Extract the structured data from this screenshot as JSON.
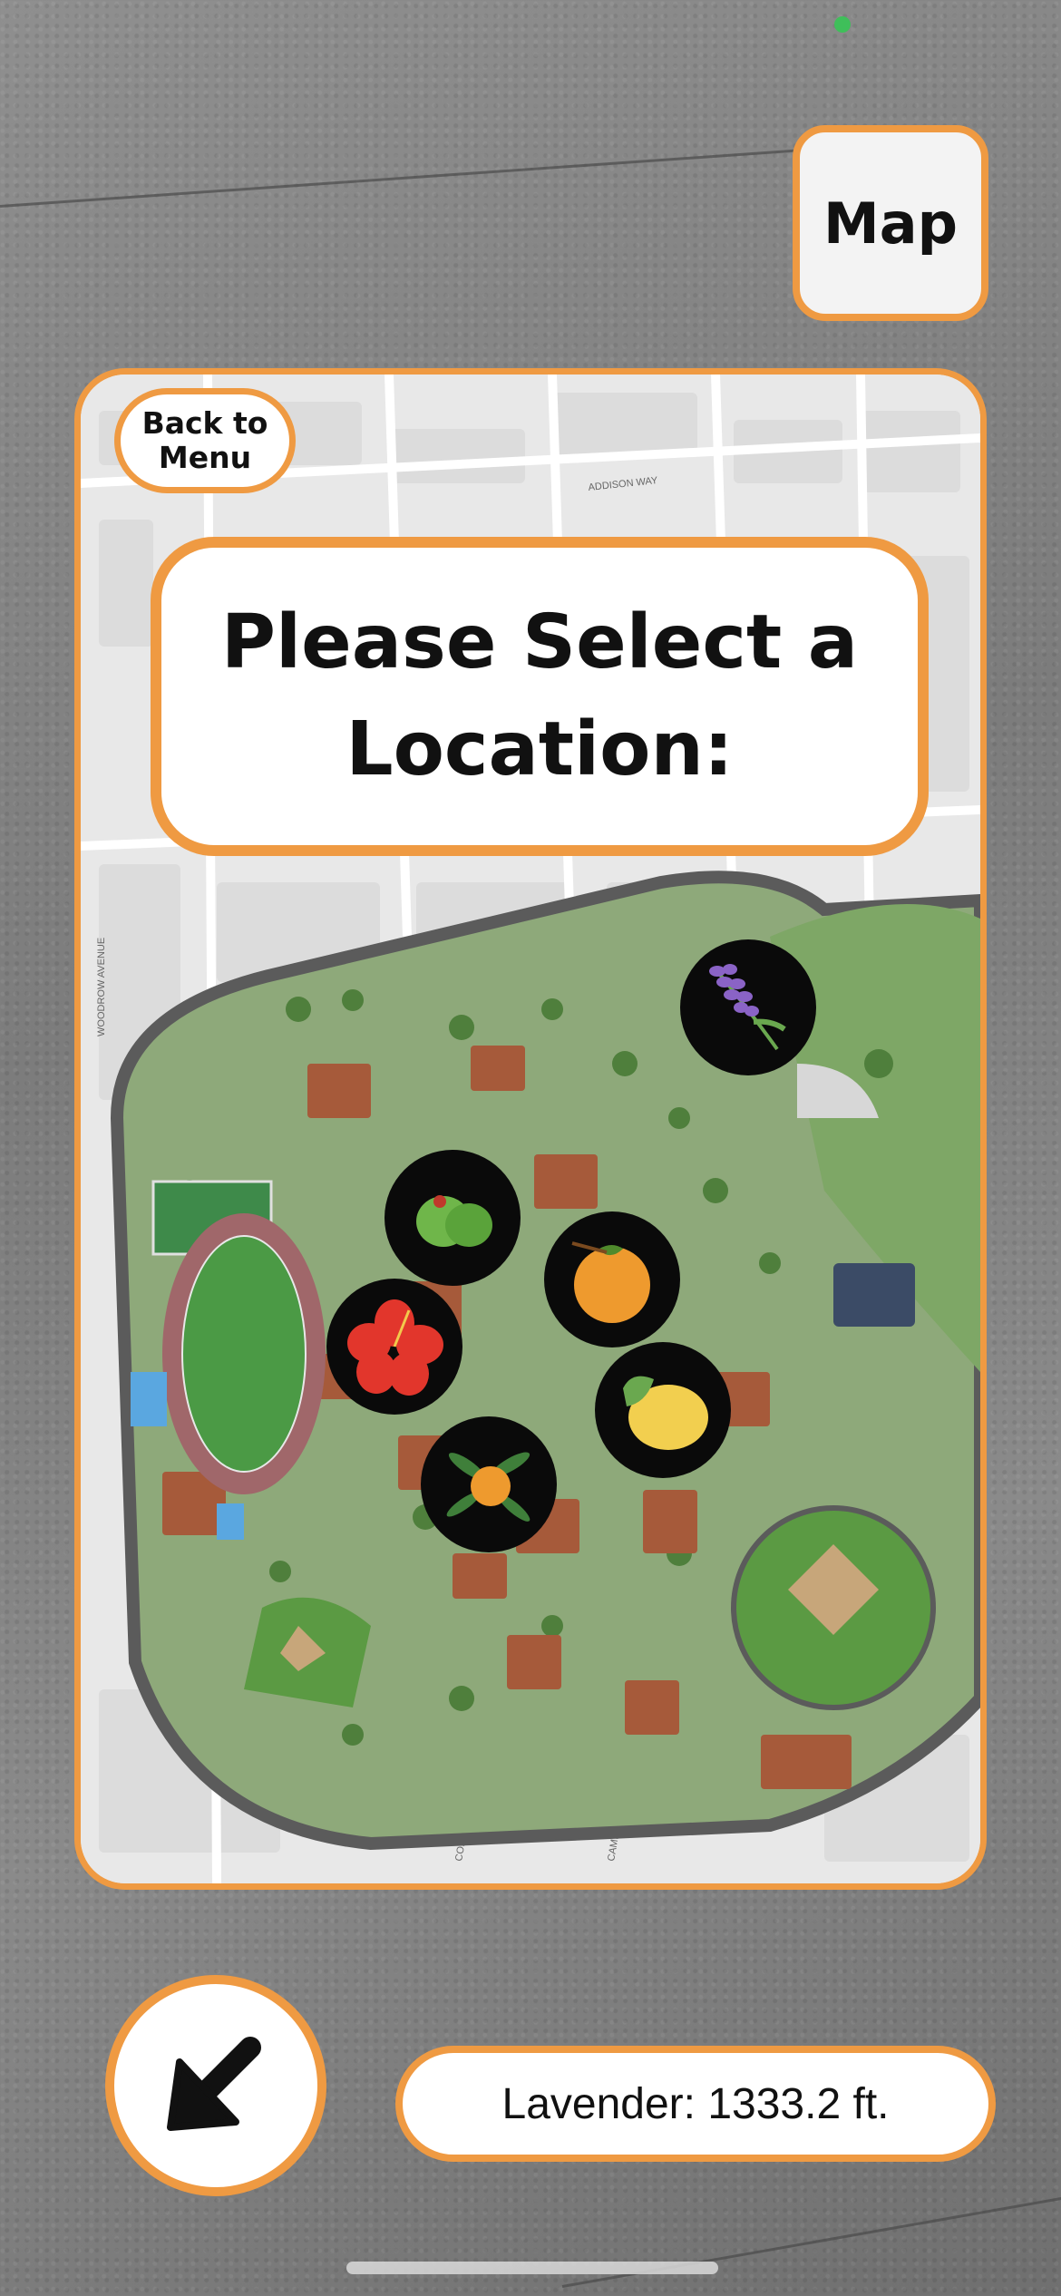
{
  "map_button": {
    "label": "Map"
  },
  "back_button": {
    "label": "Back to Menu"
  },
  "prompt": {
    "title": "Please Select a Location:"
  },
  "map": {
    "street_labels": [
      "ADDISON WAY",
      "WOODROW AVENUE",
      "COLLEGE AVENUE",
      "CAMPUS RD"
    ]
  },
  "locations": [
    {
      "name": "Lavender",
      "icon": "lavender-icon"
    },
    {
      "name": "Olive",
      "icon": "olive-icon"
    },
    {
      "name": "Orange",
      "icon": "orange-icon"
    },
    {
      "name": "Hibiscus",
      "icon": "hibiscus-icon"
    },
    {
      "name": "Lemon",
      "icon": "lemon-icon"
    },
    {
      "name": "Kumquat",
      "icon": "kumquat-icon"
    }
  ],
  "direction": {
    "icon": "arrow-down-left-icon"
  },
  "distance": {
    "text": "Lavender: 1333.2 ft."
  },
  "colors": {
    "accent": "#ef9a42",
    "button_bg": "#ffffff",
    "status_dot": "#3fbf5a"
  }
}
